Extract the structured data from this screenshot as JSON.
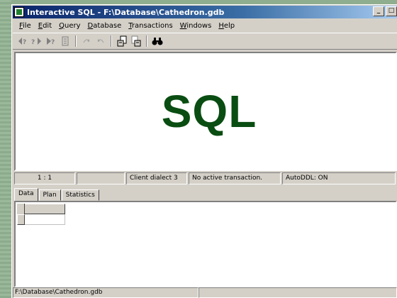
{
  "window": {
    "title": "Interactive SQL - F:\\Database\\Cathedron.gdb",
    "controls": [
      "_",
      "□"
    ]
  },
  "menu": [
    {
      "label": "File",
      "u": "F",
      "rest": "ile"
    },
    {
      "label": "Edit",
      "u": "E",
      "rest": "dit"
    },
    {
      "label": "Query",
      "u": "Q",
      "rest": "uery"
    },
    {
      "label": "Database",
      "u": "D",
      "rest": "atabase"
    },
    {
      "label": "Transactions",
      "u": "T",
      "rest": "ransactions"
    },
    {
      "label": "Windows",
      "u": "W",
      "rest": "indows"
    },
    {
      "label": "Help",
      "u": "H",
      "rest": "elp"
    }
  ],
  "toolbar": {
    "icons": [
      "previous-query-icon",
      "next-query-icon",
      "execute-query-icon",
      "prepare-icon",
      "commit-icon",
      "rollback-icon",
      "load-script-icon",
      "save-script-icon",
      "find-icon"
    ]
  },
  "editor": {
    "text": "SQL",
    "text_color": "#0a4d12"
  },
  "status": {
    "position": "1 :  1",
    "blank": "",
    "dialect": "Client dialect 3",
    "transaction": "No active transaction.",
    "autoddl": "AutoDDL: ON"
  },
  "tabs": [
    "Data",
    "Plan",
    "Statistics"
  ],
  "bottom_status": {
    "path": "F:\\Database\\Cathedron.gdb"
  }
}
